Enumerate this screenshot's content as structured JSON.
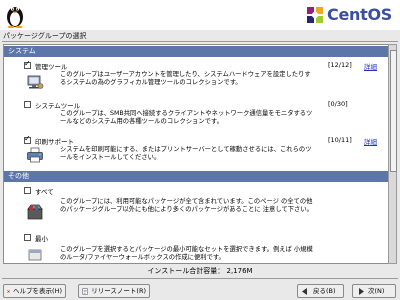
{
  "brand": {
    "logo_text": "CentOS",
    "accent": "#5d76a9",
    "logo_color": "#3b4fa0"
  },
  "page_title": "パッケージグループの選択",
  "sections": [
    {
      "title": "システム",
      "groups": [
        {
          "name": "管理ツール",
          "checked": true,
          "count": "[12/12]",
          "details_label": "詳細",
          "icon": "admin-tools-icon",
          "description": "このグループはユーザーアカウントを管理したり、システムハードウェアを設定したりするシステムの為のグラフィカル管理ツールのコレクションです。"
        },
        {
          "name": "システムツール",
          "checked": false,
          "count": "[0/30]",
          "details_label": "",
          "icon": "system-tools-icon",
          "description": "このグループは、SMB共同へ接続するクライアントやネットワーク通信量をモニタするツールなどのシステム用の各種ツールのコレクションです。"
        },
        {
          "name": "印刷サポート",
          "checked": true,
          "count": "[10/11]",
          "details_label": "詳細",
          "icon": "printer-icon",
          "description": "システムを印刷可能にする、またはプリントサーバーとして稼動させるには、これらのツールをインストールしてください。"
        }
      ]
    },
    {
      "title": "その他",
      "groups": [
        {
          "name": "すべて",
          "checked": false,
          "count": "",
          "details_label": "",
          "icon": "everything-icon",
          "description": "このグループには、利用可能なパッケージが全て含まれています。このページ の全ての他のパッケージグループ以外にも他により多くのパッケージがあることに 注意して下さい。"
        },
        {
          "name": "最小",
          "checked": false,
          "count": "",
          "details_label": "",
          "icon": "minimal-icon",
          "description": "このグループを選択するとパッケージの最小可能なセットを選択できます。例えば 小規模のルータ/ファイヤーウォールボックスの作成に便利です。"
        }
      ]
    }
  ],
  "status": "インストール合計容量： 2,176M",
  "buttons": {
    "help": "ヘルプを表示(H)",
    "release_notes": "リリースノート(R)",
    "back": "戻る(B)",
    "next": "次(N)"
  }
}
